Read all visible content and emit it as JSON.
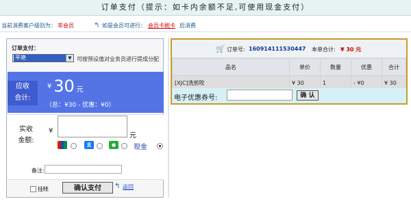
{
  "header": {
    "title": "订单支付（提示：如卡内余额不足,可使用现金支付）"
  },
  "info": {
    "customer_level_label": "当前消费客户级别为：",
    "customer_level": "非会员",
    "member_hint": "如是会员可进行：",
    "member_link": "会员卡刷卡",
    "member_suffix": "后消费"
  },
  "payment": {
    "section_label": "订单支付：",
    "operator_selected": "平艳",
    "operator_hint": "可按预设值对业务员进行提成分配",
    "due_label_1": "应收",
    "due_label_2": "合计:",
    "due_currency": "¥",
    "due_amount": "30",
    "due_unit": "元",
    "due_detail": "（总：¥30 - 优惠：¥0）",
    "received_label_1": "实收",
    "received_label_2": "金额:",
    "received_currency": "¥",
    "received_unit": "元",
    "cash_label": "现金",
    "remark_label": "备注:",
    "hold_label": "挂帐",
    "confirm_label": "确认支付",
    "back_label": "返回"
  },
  "order": {
    "order_no_label": "订单号:",
    "order_no": "160914111530447",
    "total_label": "本单合计:",
    "total_value": "¥ 30 元",
    "columns": [
      "品名",
      "单价",
      "数量",
      "优惠",
      "合计"
    ],
    "rows": [
      {
        "name": "[XJC]洗剪吹",
        "price": "¥ 30",
        "qty": "1",
        "discount": "- ¥0",
        "subtotal": "¥ 30"
      }
    ],
    "coupon_label": "电子优惠券号:",
    "coupon_button": "确 认"
  },
  "colors": {
    "accent_blue": "#5474e6",
    "order_border": "#c89a2a",
    "alert_red": "#d40000"
  }
}
